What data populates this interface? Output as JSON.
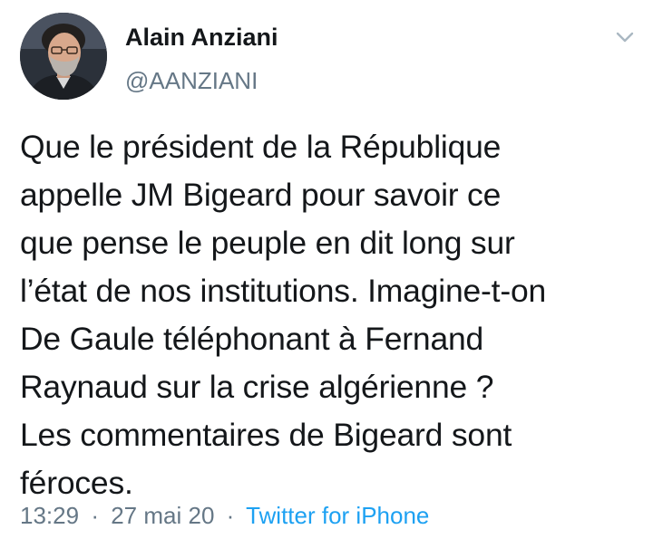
{
  "author": {
    "name": "Alain Anziani",
    "handle": "@AANZIANI"
  },
  "tweet": {
    "text": "Que le président de la République\nappelle JM Bigeard pour savoir ce\nque pense le peuple en dit long sur\nl’état de nos institutions. Imagine-t-on\nDe Gaule téléphonant à Fernand\nRaynaud sur la crise algérienne ?\nLes commentaires de Bigeard sont\nféroces."
  },
  "meta": {
    "time": "13:29",
    "separator": "·",
    "date": "27 mai 20",
    "source": "Twitter for iPhone"
  },
  "icons": {
    "menu": "chevron-down-icon"
  },
  "colors": {
    "text": "#14171a",
    "secondary": "#657786",
    "link": "#1da1f2"
  }
}
